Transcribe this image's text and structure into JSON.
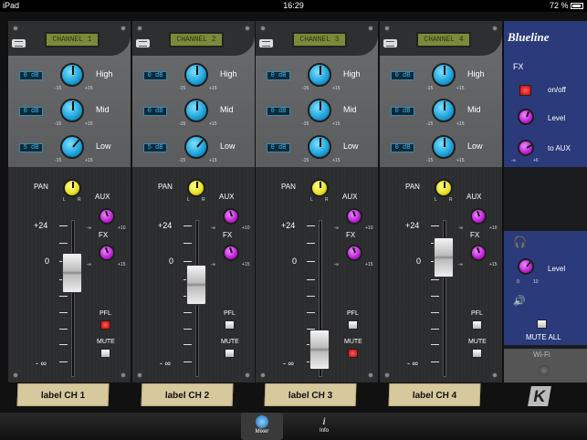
{
  "status": {
    "device": "iPad",
    "time": "16:29",
    "battery": "72 %"
  },
  "channels": [
    {
      "lcd": "CHANNEL 1",
      "label": "label CH 1",
      "db_high": "0 dB",
      "db_mid": "0 dB",
      "db_low": "5 dB",
      "fader_level": 0.72,
      "pfl_on": true,
      "mute_on": false
    },
    {
      "lcd": "CHANNEL 2",
      "label": "label CH 2",
      "db_high": "0 dB",
      "db_mid": "0 dB",
      "db_low": "5 dB",
      "fader_level": 0.62,
      "pfl_on": false,
      "mute_on": false
    },
    {
      "lcd": "CHANNEL 3",
      "label": "label CH 3",
      "db_high": "0 dB",
      "db_mid": "0 dB",
      "db_low": "0 dB",
      "fader_level": 0.06,
      "pfl_on": false,
      "mute_on": true
    },
    {
      "lcd": "CHANNEL 4",
      "label": "label CH 4",
      "db_high": "0 dB",
      "db_mid": "0 dB",
      "db_low": "0 dB",
      "fader_level": 0.85,
      "pfl_on": false,
      "mute_on": false
    }
  ],
  "strip": {
    "eq_high": "High",
    "eq_mid": "Mid",
    "eq_low": "Low",
    "eq_min": "-15",
    "eq_max": "+15",
    "pan": "PAN",
    "pan_l": "L",
    "pan_r": "R",
    "aux": "AUX",
    "aux_min": "-∞",
    "aux_max": "+10",
    "aux_zero": "0",
    "fx": "FX",
    "fx_min": "-∞",
    "fx_max": "+15",
    "fx_zero": "0",
    "scale_top": "+24",
    "scale_zero": "0",
    "scale_bottom": "- ∞",
    "pfl": "PFL",
    "mute": "MUTE"
  },
  "blueline": {
    "brand": "Blueline",
    "fx_title": "FX",
    "onoff": "on/off",
    "level": "Level",
    "to_aux": "to AUX",
    "knob_min": "-∞",
    "knob_zero": "0",
    "knob_max": "+6",
    "hp_level": "Level",
    "hp_min": "0",
    "hp_max": "10",
    "mute_all": "MUTE ALL",
    "wifi": "Wi-Fi"
  },
  "tabs": [
    {
      "label": "Mixer"
    },
    {
      "label": "Info"
    }
  ],
  "colors": {
    "knob_eq": "#1aa0d8",
    "knob_pan": "#e8e020",
    "knob_send": "#c020d8",
    "blueline_panel": "#2a3a7a",
    "button_on": "#c00000"
  }
}
